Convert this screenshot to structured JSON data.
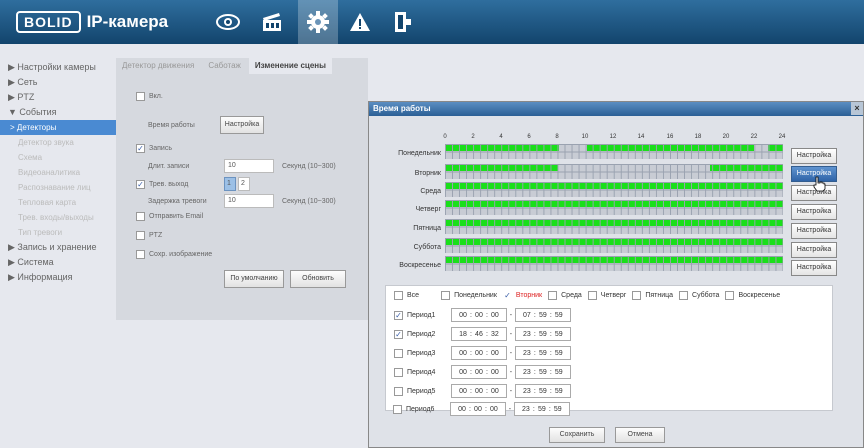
{
  "header": {
    "logo_box": "BOLID",
    "logo_text": "IP-камера",
    "icons": [
      "eye-icon",
      "film-icon",
      "gear-icon",
      "alarm-icon",
      "logout-icon"
    ]
  },
  "sidebar": {
    "items": [
      "▶ Настройки камеры",
      "▶ Сеть",
      "▶ PTZ",
      "▼ События"
    ],
    "active": "> Детекторы",
    "subs": [
      "Детектор звука",
      "Схема",
      "Видеоаналитика",
      "Распознавание лиц",
      "Тепловая карта",
      "Трев. входы/выходы",
      "Тип тревоги"
    ],
    "items2": [
      "▶ Запись и хранение",
      "▶ Система",
      "▶ Информация"
    ]
  },
  "tabs": [
    "Детектор движения",
    "Саботаж",
    "Изменение сцены"
  ],
  "form": {
    "enable": "Вкл.",
    "schedule_label": "Время работы",
    "schedule_btn": "Настройка",
    "record": "Запись",
    "record_len_label": "Длит. записи",
    "record_len_value": "10",
    "record_len_hint": "Секунд (10~300)",
    "alarm_out": "Трев. выход",
    "alarm_out_opts": [
      "1",
      "2"
    ],
    "alarm_delay_label": "Задержка тревоги",
    "alarm_delay_value": "10",
    "alarm_delay_hint": "Секунд (10~300)",
    "send_email": "Отправить Email",
    "ptz": "PTZ",
    "save_image": "Сохр. изображение",
    "default_btn": "По умолчанию",
    "refresh_btn": "Обновить"
  },
  "dialog": {
    "title": "Время работы",
    "close": "×",
    "ticks": [
      "0",
      "2",
      "4",
      "6",
      "8",
      "10",
      "12",
      "14",
      "16",
      "18",
      "20",
      "22",
      "24"
    ],
    "days": [
      "Понедельник",
      "Вторник",
      "Среда",
      "Четверг",
      "Пятница",
      "Суббота",
      "Воскресенье"
    ],
    "setup_btn": "Настройка",
    "schedule_colors": {
      "active": "#1adf1a"
    },
    "all_label": "Все",
    "day_checks": [
      "Понедельник",
      "Вторник",
      "Среда",
      "Четверг",
      "Пятница",
      "Суббота",
      "Воскресенье"
    ],
    "periods": [
      {
        "label": "Период1",
        "checked": true,
        "from": [
          "00",
          "00",
          "00"
        ],
        "to": [
          "07",
          "59",
          "59"
        ]
      },
      {
        "label": "Период2",
        "checked": true,
        "from": [
          "18",
          "46",
          "32"
        ],
        "to": [
          "23",
          "59",
          "59"
        ]
      },
      {
        "label": "Период3",
        "checked": false,
        "from": [
          "00",
          "00",
          "00"
        ],
        "to": [
          "23",
          "59",
          "59"
        ]
      },
      {
        "label": "Период4",
        "checked": false,
        "from": [
          "00",
          "00",
          "00"
        ],
        "to": [
          "23",
          "59",
          "59"
        ]
      },
      {
        "label": "Период5",
        "checked": false,
        "from": [
          "00",
          "00",
          "00"
        ],
        "to": [
          "23",
          "59",
          "59"
        ]
      },
      {
        "label": "Период6",
        "checked": false,
        "from": [
          "00",
          "00",
          "00"
        ],
        "to": [
          "23",
          "59",
          "59"
        ]
      }
    ],
    "save": "Сохранить",
    "cancel": "Отмена"
  }
}
